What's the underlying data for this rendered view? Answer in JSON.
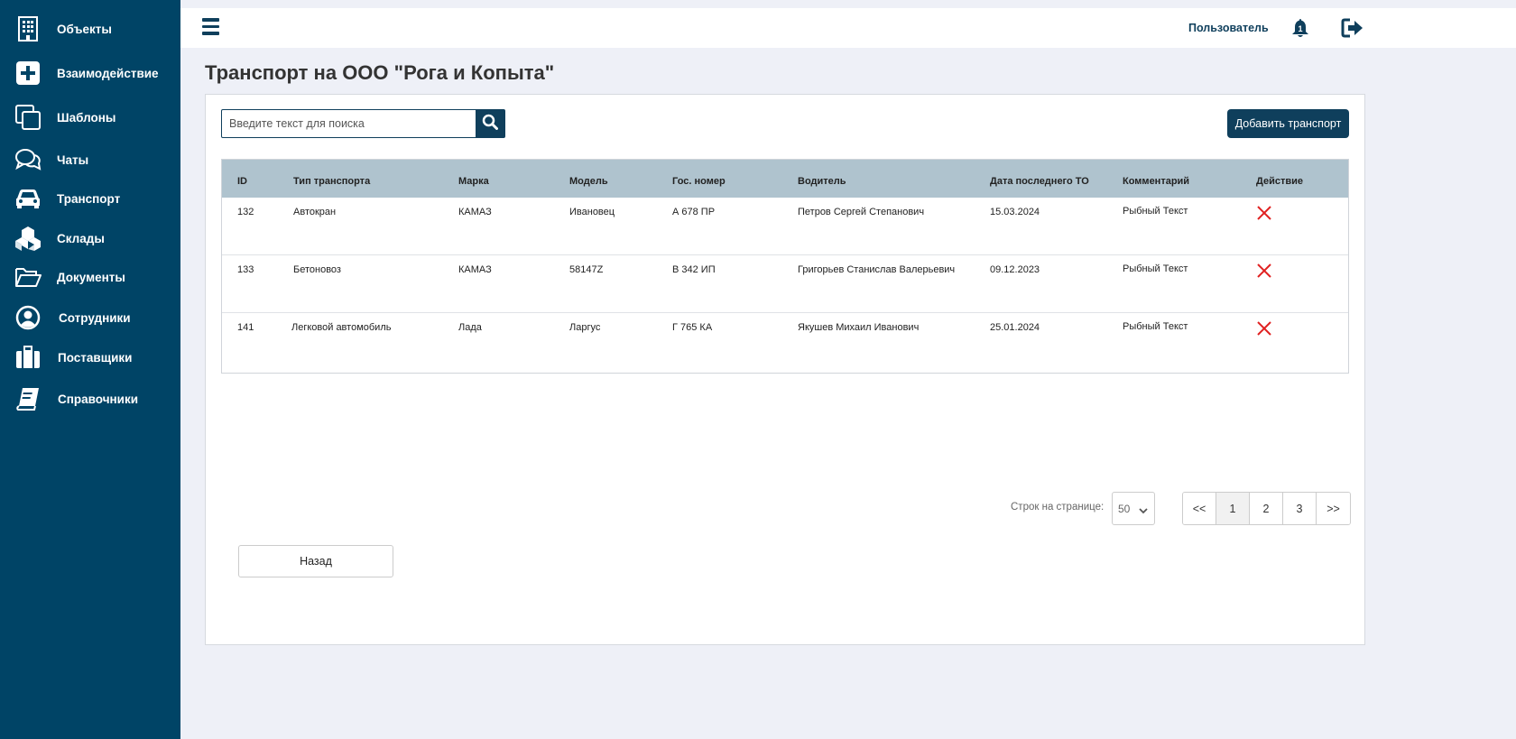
{
  "sidebar": {
    "items": [
      {
        "label": "Объекты",
        "icon": "building-icon"
      },
      {
        "label": "Взаимодействие",
        "icon": "plus-square-icon"
      },
      {
        "label": "Шаблоны",
        "icon": "copy-icon"
      },
      {
        "label": "Чаты",
        "icon": "chat-icon"
      },
      {
        "label": "Транспорт",
        "icon": "car-icon"
      },
      {
        "label": "Склады",
        "icon": "boxes-icon"
      },
      {
        "label": "Документы",
        "icon": "folder-open-icon"
      },
      {
        "label": "Сотрудники",
        "icon": "user-circle-icon"
      },
      {
        "label": "Поставщики",
        "icon": "briefcase-icon"
      },
      {
        "label": "Справочники",
        "icon": "book-icon"
      }
    ]
  },
  "header": {
    "user_label": "Пользователь"
  },
  "page": {
    "title": "Транспорт на ООО \"Рога и Копыта\""
  },
  "search": {
    "placeholder": "Введите текст для поиска"
  },
  "add_button_label": "Добавить транспорт",
  "table": {
    "columns": [
      "ID",
      "Тип транспорта",
      "Марка",
      "Модель",
      "Гос. номер",
      "Водитель",
      "Дата последнего ТО",
      "Комментарий",
      "Действие"
    ],
    "rows": [
      [
        "132",
        "Автокран",
        "КАМАЗ",
        "Ивановец",
        "А 678 ПР",
        "Петров Сергей Степанович",
        "15.03.2024",
        "Рыбный Текст"
      ],
      [
        "133",
        "Бетоновоз",
        "КАМАЗ",
        "58147Z",
        "В 342 ИП",
        "Григорьев Станислав Валерьевич",
        "09.12.2023",
        "Рыбный Текст"
      ],
      [
        "141",
        "Легковой автомобиль",
        "Лада",
        "Ларгус",
        "Г 765 КА",
        "Якушев Михаил Иванович",
        "25.01.2024",
        "Рыбный Текст"
      ]
    ]
  },
  "pagination": {
    "rows_label": "Строк на странице:",
    "rows_value": "50",
    "buttons": [
      "<<",
      "1",
      "2",
      "3",
      ">>"
    ],
    "active": "1"
  },
  "back_button_label": "Назад",
  "colors": {
    "sidebar_bg": "#004466",
    "primary": "#0f3f5c",
    "table_header": "#afc3ce",
    "delete": "#e02020",
    "page_bg": "#eef0f7"
  }
}
